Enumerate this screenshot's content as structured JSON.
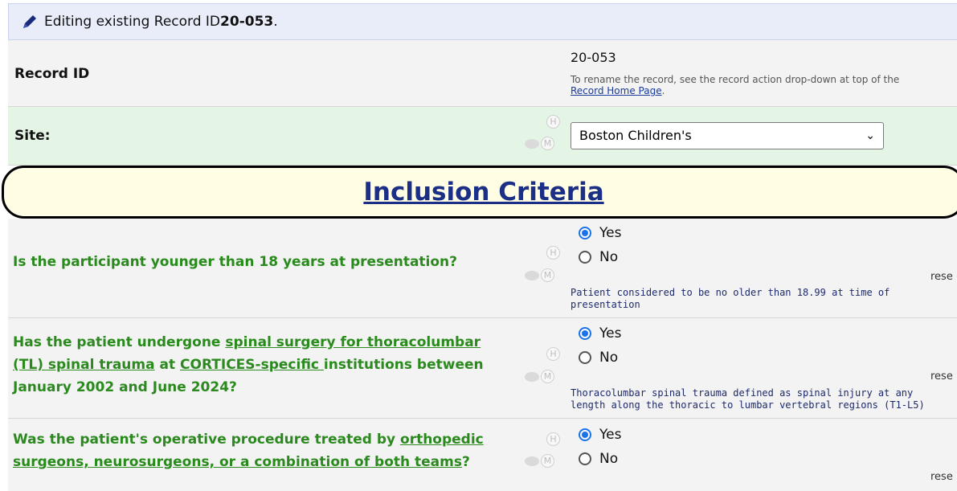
{
  "banner": {
    "prefix": "Editing existing Record ID ",
    "record_id": "20-053",
    "suffix": "."
  },
  "record_row": {
    "label": "Record ID",
    "value": "20-053",
    "note_text": "To rename the record, see the record action drop-down at top of the",
    "note_link": "Record Home Page",
    "note_end": "."
  },
  "site_row": {
    "label": "Site:",
    "selected": "Boston Children's"
  },
  "icons": {
    "history": "H",
    "missing": "M"
  },
  "section": {
    "title": "Inclusion Criteria"
  },
  "questions": [
    {
      "text": "Is the participant younger than 18 years at presentation?",
      "options": [
        "Yes",
        "No"
      ],
      "selected": "Yes",
      "reset": "rese",
      "note": "Patient considered to be no older than 18.99 at time of presentation"
    },
    {
      "text_parts": [
        "Has the patient undergone ",
        "spinal surgery for thoracolumbar (TL) spinal trauma",
        " at ",
        "CORTICES-specific ",
        "institutions between January 2002 and June 2024?"
      ],
      "options": [
        "Yes",
        "No"
      ],
      "selected": "Yes",
      "reset": "rese",
      "note": "Thoracolumbar spinal trauma defined as spinal injury at any length along the thoracic to lumbar vertebral regions (T1-L5)"
    },
    {
      "text_parts": [
        "Was the patient's operative procedure treated by ",
        "orthopedic surgeons, neurosurgeons, or a combination of both teams",
        "?"
      ],
      "options": [
        "Yes",
        "No"
      ],
      "selected": "Yes",
      "reset": "rese"
    }
  ],
  "colors": {
    "banner_bg": "#e8edf9",
    "site_bg": "#e5f5e5",
    "question_green": "#2b8a1e",
    "section_title": "#1c2f86",
    "radio_on": "#1a73e8"
  }
}
